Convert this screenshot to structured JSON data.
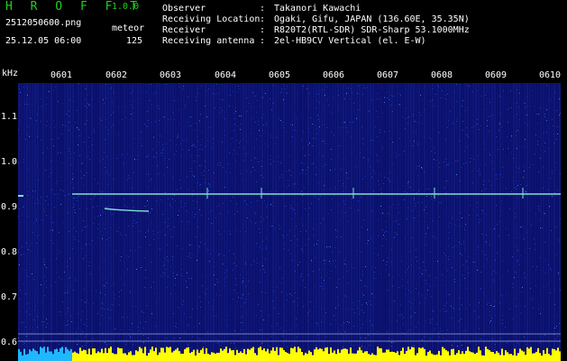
{
  "app": {
    "name": "H R O F F T",
    "version": "1.0.0"
  },
  "file": {
    "name": "2512050600.png",
    "datetime": "25.12.05 06:00"
  },
  "detection": {
    "label": "meteor",
    "count": "125"
  },
  "meta": [
    {
      "label": "Observer",
      "value": "Takanori Kawachi"
    },
    {
      "label": "Receiving Location",
      "value": "Ogaki, Gifu, JAPAN (136.60E, 35.35N)"
    },
    {
      "label": "Receiver",
      "value": "R820T2(RTL-SDR) SDR-Sharp 53.1000MHz"
    },
    {
      "label": "Receiving antenna",
      "value": "2el-HB9CV Vertical (el. E-W)"
    }
  ],
  "time_axis": [
    "0601",
    "0602",
    "0603",
    "0604",
    "0605",
    "0606",
    "0607",
    "0608",
    "0609",
    "0610"
  ],
  "freq_axis": {
    "unit": "kHz",
    "ticks": [
      "1.1",
      "1.0",
      "0.9",
      "0.8",
      "0.7",
      "0.6"
    ]
  },
  "colors": {
    "background": "#0a0f6a",
    "trace": "#7fe0d0",
    "noise_bar": "#ffff00",
    "logo": "#20d020"
  }
}
